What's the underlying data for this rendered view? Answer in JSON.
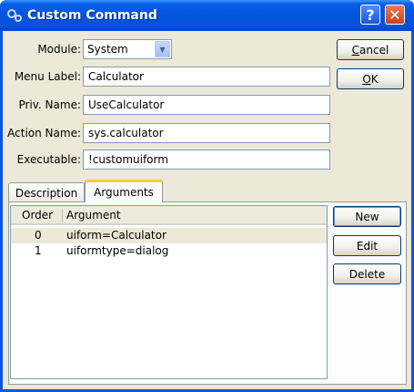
{
  "window": {
    "title": "Custom Command",
    "help_label": "?",
    "close_label": "✕"
  },
  "form": {
    "module_label": "Module:",
    "module_value": "System",
    "menu_label_label": "Menu Label:",
    "menu_label_value": "Calculator",
    "priv_name_label": "Priv. Name:",
    "priv_name_value": "UseCalculator",
    "action_name_label": "Action Name:",
    "action_name_value": "sys.calculator",
    "executable_label": "Executable:",
    "executable_value": "!customuiform"
  },
  "buttons": {
    "cancel_u": "C",
    "cancel_rest": "ancel",
    "ok_u": "O",
    "ok_rest": "K",
    "new": "New",
    "edit": "Edit",
    "delete": "Delete"
  },
  "tabs": {
    "description": "Description",
    "arguments": "Arguments"
  },
  "arguments_table": {
    "columns": [
      "Order",
      "Argument"
    ],
    "rows": [
      {
        "order": "0",
        "argument": "uiform=Calculator"
      },
      {
        "order": "1",
        "argument": "uiformtype=dialog"
      }
    ]
  }
}
